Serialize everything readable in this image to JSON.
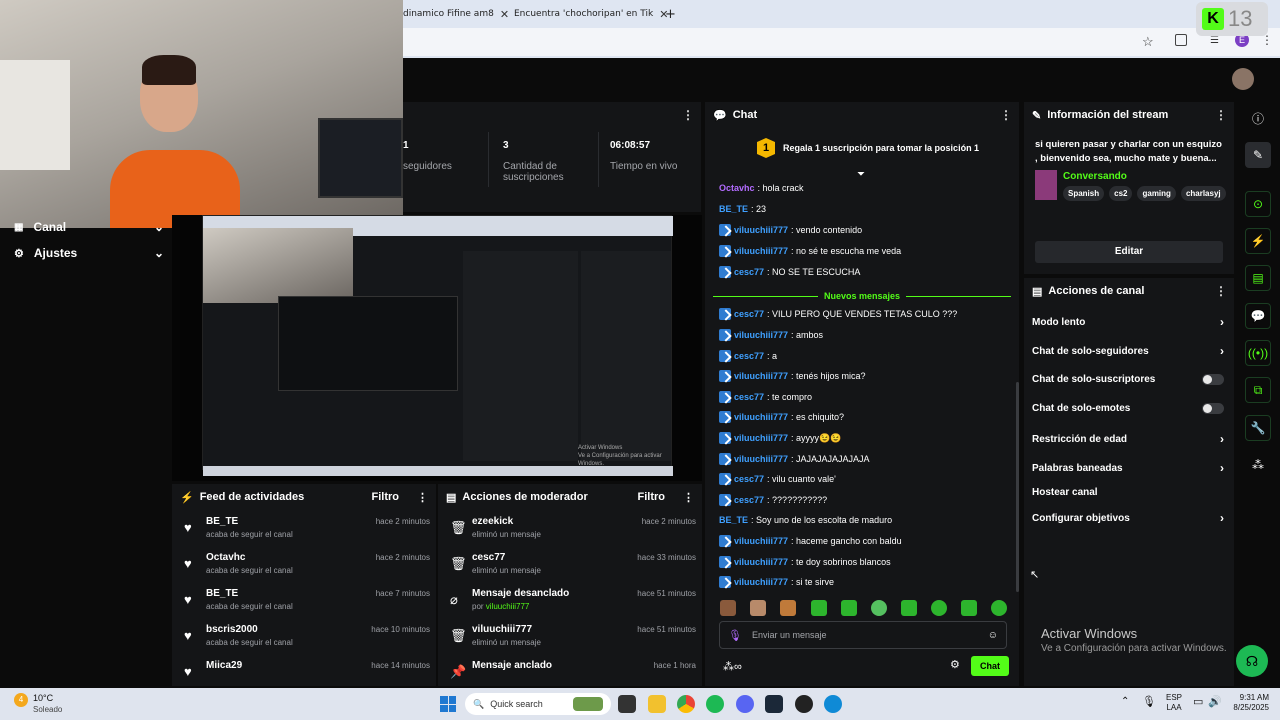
{
  "browser": {
    "tabs": [
      {
        "label": "dinamico Fifine am8"
      },
      {
        "label": "Encuentra 'chochoripan' en Tik"
      }
    ],
    "new_tab": "+",
    "profile_initial": "E"
  },
  "overlay_badge": "13",
  "sidebar": {
    "items": [
      {
        "label": "Canal"
      },
      {
        "label": "Ajustes"
      }
    ]
  },
  "stats": {
    "followers_value": "1",
    "followers_label": "seguidores",
    "subs_value": "3",
    "subs_label": "Cantidad de suscripciones",
    "time_value": "06:08:57",
    "time_label": "Tiempo en vivo"
  },
  "preview": {
    "watermark_title": "Activar Windows",
    "watermark_sub": "Ve a Configuración para activar Windows."
  },
  "activity_feed": {
    "title": "Feed de actividades",
    "filter": "Filtro",
    "rows": [
      {
        "name": "BE_TE",
        "action": "acaba de seguir el canal",
        "time": "hace 2 minutos"
      },
      {
        "name": "Octavhc",
        "action": "acaba de seguir el canal",
        "time": "hace 2 minutos"
      },
      {
        "name": "BE_TE",
        "action": "acaba de seguir el canal",
        "time": "hace 7 minutos"
      },
      {
        "name": "bscris2000",
        "action": "acaba de seguir el canal",
        "time": "hace 10 minutos"
      },
      {
        "name": "Miica29",
        "action": "",
        "time": "hace 14 minutos"
      }
    ]
  },
  "mod_actions": {
    "title": "Acciones de moderador",
    "filter": "Filtro",
    "rows": [
      {
        "name": "ezeekick",
        "action": "eliminó un mensaje",
        "time": "hace 2 minutos"
      },
      {
        "name": "cesc77",
        "action": "eliminó un mensaje",
        "time": "hace 33 minutos"
      },
      {
        "name": "Mensaje desanclado",
        "action_prefix": "por",
        "action_user": "viluuchiii777",
        "time": "hace 51 minutos"
      },
      {
        "name": "viluuchiii777",
        "action": "eliminó un mensaje",
        "time": "hace 51 minutos"
      },
      {
        "name": "Mensaje anclado",
        "action": "",
        "time": "hace 1 hora"
      }
    ]
  },
  "chat": {
    "title": "Chat",
    "pinned_number": "1",
    "pinned_text": "Regala 1 suscripción para tomar la posición 1",
    "new_messages": "Nuevos mensajes",
    "messages": [
      {
        "user": "Octavhc",
        "text": ": hola crack",
        "color": "#b36cff",
        "badge": false
      },
      {
        "user": "BE_TE",
        "text": ": 23",
        "color": "#3fa0ff",
        "badge": false
      },
      {
        "user": "viluuchiii777",
        "text": ": vendo contenido",
        "color": "#3fa0ff",
        "badge": true
      },
      {
        "user": "viluuchiii777",
        "text": ": no sé te escucha me veda",
        "color": "#3fa0ff",
        "badge": true
      },
      {
        "user": "cesc77",
        "text": ": NO SE TE ESCUCHA",
        "color": "#3fa0ff",
        "badge": true
      },
      {
        "user": "cesc77",
        "text": ": VILU PERO QUE VENDES TETAS CULO ???",
        "color": "#3fa0ff",
        "badge": true
      },
      {
        "user": "viluuchiii777",
        "text": ": ambos",
        "color": "#3fa0ff",
        "badge": true
      },
      {
        "user": "cesc77",
        "text": ": a",
        "color": "#3fa0ff",
        "badge": true
      },
      {
        "user": "viluuchiii777",
        "text": ": tenés hijos mica?",
        "color": "#3fa0ff",
        "badge": true
      },
      {
        "user": "cesc77",
        "text": ": te compro",
        "color": "#3fa0ff",
        "badge": true
      },
      {
        "user": "viluuchiii777",
        "text": ": es chiquito?",
        "color": "#3fa0ff",
        "badge": true
      },
      {
        "user": "viluuchiii777",
        "text": ": ayyyy😉😉",
        "color": "#3fa0ff",
        "badge": true
      },
      {
        "user": "viluuchiii777",
        "text": ": JAJAJAJAJAJAJA",
        "color": "#3fa0ff",
        "badge": true
      },
      {
        "user": "cesc77",
        "text": ": vilu cuanto vale'",
        "color": "#3fa0ff",
        "badge": true
      },
      {
        "user": "cesc77",
        "text": ": ???????????",
        "color": "#3fa0ff",
        "badge": true
      },
      {
        "user": "BE_TE",
        "text": ": Soy uno de los escolta de maduro",
        "color": "#3fa0ff",
        "badge": false
      },
      {
        "user": "viluuchiii777",
        "text": ": haceme gancho con baldu",
        "color": "#3fa0ff",
        "badge": true
      },
      {
        "user": "viluuchiii777",
        "text": ": te doy sobrinos blancos",
        "color": "#3fa0ff",
        "badge": true
      },
      {
        "user": "viluuchiii777",
        "text": ": si te sirve",
        "color": "#3fa0ff",
        "badge": true
      }
    ],
    "input_placeholder": "Enviar un mensaje",
    "send_label": "Chat"
  },
  "stream_info": {
    "title": "Información del stream",
    "description": "si quieren pasar y charlar con un esquizo , bienvenido sea, mucho mate y buena...",
    "category": "Conversando",
    "tags": [
      "Spanish",
      "cs2",
      "gaming",
      "charlasyj"
    ],
    "edit_label": "Editar"
  },
  "channel_actions": {
    "title": "Acciones de canal",
    "items": [
      {
        "label": "Modo lento",
        "control": "chevron"
      },
      {
        "label": "Chat de solo-seguidores",
        "control": "chevron"
      },
      {
        "label": "Chat de solo-suscriptores",
        "control": "toggle"
      },
      {
        "label": "Chat de solo-emotes",
        "control": "toggle"
      },
      {
        "label": "Restricción de edad",
        "control": "chevron"
      },
      {
        "label": "Palabras baneadas",
        "control": "chevron"
      },
      {
        "label": "Hostear canal",
        "control": "none"
      },
      {
        "label": "Configurar objetivos",
        "control": "chevron"
      }
    ]
  },
  "windows_watermark": {
    "title": "Activar Windows",
    "subtitle": "Ve a Configuración para activar Windows."
  },
  "taskbar": {
    "weather_temp": "10°C",
    "weather_desc": "Soleado",
    "weather_alert": "4",
    "search_placeholder": "Quick search",
    "lang_top": "ESP",
    "lang_bottom": "LAA",
    "time": "9:31 AM",
    "date": "8/25/2025"
  },
  "colors": {
    "accent": "#53fc18",
    "panel": "#141517",
    "background": "#0b0b0b"
  }
}
